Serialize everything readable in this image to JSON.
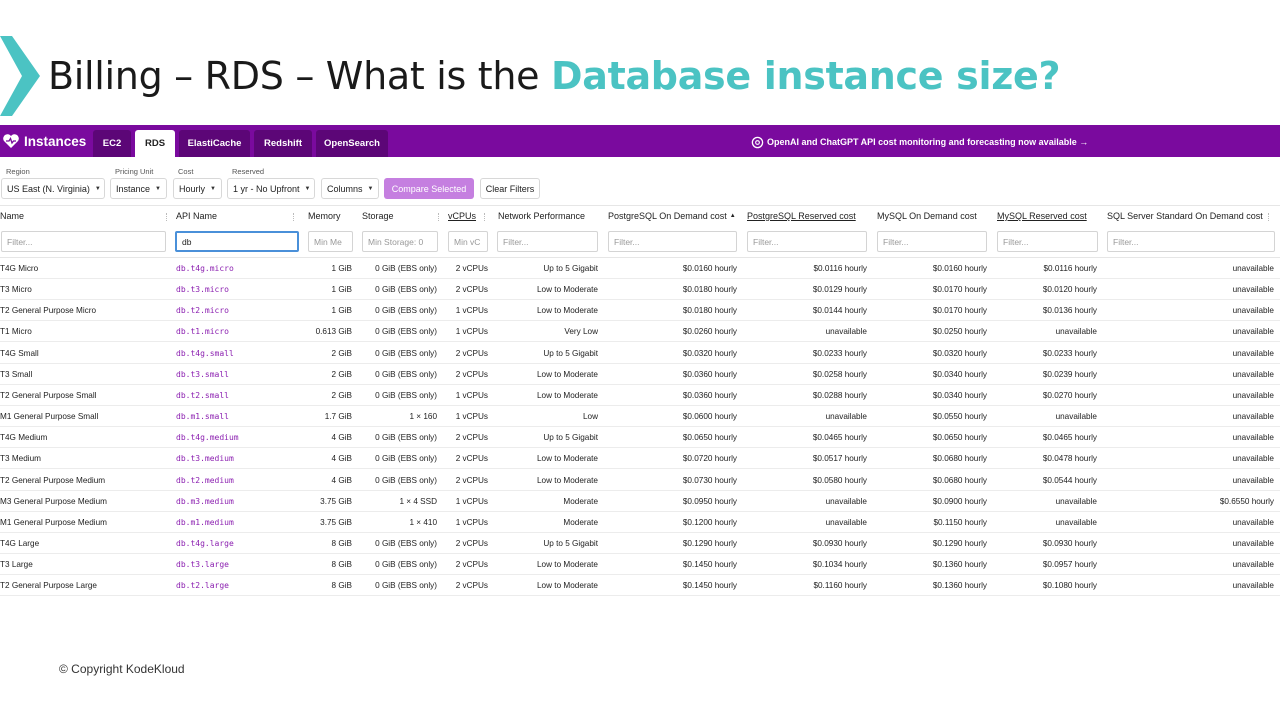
{
  "slide": {
    "title_prefix": "Billing – RDS – What is the ",
    "title_highlight": "Database instance size?",
    "copyright": "© Copyright KodeKloud",
    "accent_color": "#4bc3c3"
  },
  "nav": {
    "brand": "Instances",
    "bar_color": "#7a0a9e",
    "tabs": [
      {
        "label": "EC2",
        "active": false
      },
      {
        "label": "RDS",
        "active": true
      },
      {
        "label": "ElastiCache",
        "active": false
      },
      {
        "label": "Redshift",
        "active": false
      },
      {
        "label": "OpenSearch",
        "active": false
      }
    ],
    "announcement": "OpenAI and ChatGPT API cost monitoring and forecasting now available →"
  },
  "filters": {
    "region": {
      "label": "Region",
      "value": "US East (N. Virginia)"
    },
    "pricing_unit": {
      "label": "Pricing Unit",
      "value": "Instance"
    },
    "cost": {
      "label": "Cost",
      "value": "Hourly"
    },
    "reserved": {
      "label": "Reserved",
      "value": "1 yr - No Upfront"
    },
    "columns": {
      "value": "Columns"
    },
    "compare_button": "Compare Selected",
    "clear_button": "Clear Filters"
  },
  "table": {
    "headers": [
      "Name",
      "API Name",
      "Memory",
      "Storage",
      "vCPUs",
      "Network Performance",
      "PostgreSQL On Demand cost",
      "PostgreSQL Reserved cost",
      "MySQL On Demand cost",
      "MySQL Reserved cost",
      "SQL Server Standard On Demand cost"
    ],
    "filter_inputs": [
      {
        "placeholder": "Filter...",
        "value": ""
      },
      {
        "placeholder": "Filter...",
        "value": "db"
      },
      {
        "placeholder": "Min Me",
        "value": ""
      },
      {
        "placeholder": "Min Storage: 0",
        "value": ""
      },
      {
        "placeholder": "Min vC",
        "value": ""
      },
      {
        "placeholder": "Filter...",
        "value": ""
      },
      {
        "placeholder": "Filter...",
        "value": ""
      },
      {
        "placeholder": "Filter...",
        "value": ""
      },
      {
        "placeholder": "Filter...",
        "value": ""
      },
      {
        "placeholder": "Filter...",
        "value": ""
      },
      {
        "placeholder": "Filter...",
        "value": ""
      }
    ],
    "rows": [
      [
        "T4G Micro",
        "db.t4g.micro",
        "1 GiB",
        "0 GiB (EBS only)",
        "2 vCPUs",
        "Up to 5 Gigabit",
        "$0.0160 hourly",
        "$0.0116 hourly",
        "$0.0160 hourly",
        "$0.0116 hourly",
        "unavailable"
      ],
      [
        "T3 Micro",
        "db.t3.micro",
        "1 GiB",
        "0 GiB (EBS only)",
        "2 vCPUs",
        "Low to Moderate",
        "$0.0180 hourly",
        "$0.0129 hourly",
        "$0.0170 hourly",
        "$0.0120 hourly",
        "unavailable"
      ],
      [
        "T2 General Purpose Micro",
        "db.t2.micro",
        "1 GiB",
        "0 GiB (EBS only)",
        "1 vCPUs",
        "Low to Moderate",
        "$0.0180 hourly",
        "$0.0144 hourly",
        "$0.0170 hourly",
        "$0.0136 hourly",
        "unavailable"
      ],
      [
        "T1 Micro",
        "db.t1.micro",
        "0.613 GiB",
        "0 GiB (EBS only)",
        "1 vCPUs",
        "Very Low",
        "$0.0260 hourly",
        "unavailable",
        "$0.0250 hourly",
        "unavailable",
        "unavailable"
      ],
      [
        "T4G Small",
        "db.t4g.small",
        "2 GiB",
        "0 GiB (EBS only)",
        "2 vCPUs",
        "Up to 5 Gigabit",
        "$0.0320 hourly",
        "$0.0233 hourly",
        "$0.0320 hourly",
        "$0.0233 hourly",
        "unavailable"
      ],
      [
        "T3 Small",
        "db.t3.small",
        "2 GiB",
        "0 GiB (EBS only)",
        "2 vCPUs",
        "Low to Moderate",
        "$0.0360 hourly",
        "$0.0258 hourly",
        "$0.0340 hourly",
        "$0.0239 hourly",
        "unavailable"
      ],
      [
        "T2 General Purpose Small",
        "db.t2.small",
        "2 GiB",
        "0 GiB (EBS only)",
        "1 vCPUs",
        "Low to Moderate",
        "$0.0360 hourly",
        "$0.0288 hourly",
        "$0.0340 hourly",
        "$0.0270 hourly",
        "unavailable"
      ],
      [
        "M1 General Purpose Small",
        "db.m1.small",
        "1.7 GiB",
        "1 × 160",
        "1 vCPUs",
        "Low",
        "$0.0600 hourly",
        "unavailable",
        "$0.0550 hourly",
        "unavailable",
        "unavailable"
      ],
      [
        "T4G Medium",
        "db.t4g.medium",
        "4 GiB",
        "0 GiB (EBS only)",
        "2 vCPUs",
        "Up to 5 Gigabit",
        "$0.0650 hourly",
        "$0.0465 hourly",
        "$0.0650 hourly",
        "$0.0465 hourly",
        "unavailable"
      ],
      [
        "T3 Medium",
        "db.t3.medium",
        "4 GiB",
        "0 GiB (EBS only)",
        "2 vCPUs",
        "Low to Moderate",
        "$0.0720 hourly",
        "$0.0517 hourly",
        "$0.0680 hourly",
        "$0.0478 hourly",
        "unavailable"
      ],
      [
        "T2 General Purpose Medium",
        "db.t2.medium",
        "4 GiB",
        "0 GiB (EBS only)",
        "2 vCPUs",
        "Low to Moderate",
        "$0.0730 hourly",
        "$0.0580 hourly",
        "$0.0680 hourly",
        "$0.0544 hourly",
        "unavailable"
      ],
      [
        "M3 General Purpose Medium",
        "db.m3.medium",
        "3.75 GiB",
        "1 × 4 SSD",
        "1 vCPUs",
        "Moderate",
        "$0.0950 hourly",
        "unavailable",
        "$0.0900 hourly",
        "unavailable",
        "$0.6550 hourly"
      ],
      [
        "M1 General Purpose Medium",
        "db.m1.medium",
        "3.75 GiB",
        "1 × 410",
        "1 vCPUs",
        "Moderate",
        "$0.1200 hourly",
        "unavailable",
        "$0.1150 hourly",
        "unavailable",
        "unavailable"
      ],
      [
        "T4G Large",
        "db.t4g.large",
        "8 GiB",
        "0 GiB (EBS only)",
        "2 vCPUs",
        "Up to 5 Gigabit",
        "$0.1290 hourly",
        "$0.0930 hourly",
        "$0.1290 hourly",
        "$0.0930 hourly",
        "unavailable"
      ],
      [
        "T3 Large",
        "db.t3.large",
        "8 GiB",
        "0 GiB (EBS only)",
        "2 vCPUs",
        "Low to Moderate",
        "$0.1450 hourly",
        "$0.1034 hourly",
        "$0.1360 hourly",
        "$0.0957 hourly",
        "unavailable"
      ],
      [
        "T2 General Purpose Large",
        "db.t2.large",
        "8 GiB",
        "0 GiB (EBS only)",
        "2 vCPUs",
        "Low to Moderate",
        "$0.1450 hourly",
        "$0.1160 hourly",
        "$0.1360 hourly",
        "$0.1080 hourly",
        "unavailable"
      ]
    ]
  }
}
